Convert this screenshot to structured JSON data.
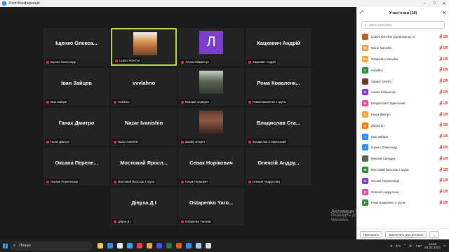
{
  "window": {
    "title": "Zoom Конференція",
    "controls": [
      "–",
      "□",
      "✕"
    ]
  },
  "gallery": {
    "tiles": [
      {
        "name": "Іщенко  Олекса...",
        "badge": "Іщенко Олександр",
        "kind": "name"
      },
      {
        "name": "",
        "badge": "Liubov Honchar",
        "kind": "photo",
        "photo": "ph-lyubov",
        "active": true
      },
      {
        "name": "",
        "badge": "Алина Кобринчук",
        "kind": "letter",
        "letter": "Л"
      },
      {
        "name": "Хацкевич  Андрій",
        "badge": "Хацкевич Андрій",
        "kind": "name"
      },
      {
        "name": "Іван  Зайцев",
        "badge": "Іван Зайцев",
        "kind": "name"
      },
      {
        "name": "vvvlahno",
        "badge": "vvvlahno",
        "kind": "name"
      },
      {
        "name": "",
        "badge": "Максим Середюк",
        "kind": "photo",
        "photo": "ph-maksym"
      },
      {
        "name": "Рома  Коваленк...",
        "badge": "Рома Коваленко 2 група",
        "kind": "name"
      },
      {
        "name": "Ганах  Дмитро",
        "badge": "Ганах Дмитро",
        "kind": "name"
      },
      {
        "name": "Nazar  Ivanishin",
        "badge": "Nazar Ivanishin",
        "kind": "name"
      },
      {
        "name": "",
        "badge": "Zavaliy Dmytro",
        "kind": "photo",
        "photo": "ph-zavaliy"
      },
      {
        "name": "Владислав  Ста...",
        "badge": "Владислав Старинський",
        "kind": "name"
      },
      {
        "name": "Оксана  Перепе...",
        "badge": "Оксана Перепелиця",
        "kind": "name"
      },
      {
        "name": "Мостовий  Яросл...",
        "badge": "Мостовий Ярослав 2 група",
        "kind": "name"
      },
      {
        "name": "Севак  Норікович",
        "badge": "Севак Норікович",
        "kind": "name"
      },
      {
        "name": "Олексій  Андру...",
        "badge": "Олексій Андрусенко",
        "kind": "name"
      },
      {
        "name": "Дівуха  Д  І",
        "badge": "Дівуха Д І",
        "kind": "name"
      },
      {
        "name": "Ostapenko  Yaro...",
        "badge": "Ostapenko Yaroslav",
        "kind": "name"
      }
    ]
  },
  "watermark": {
    "title": "Активаця Windows",
    "line1": "Перейдіть до розділу ''Настройки'', щоб",
    "line2": "Windows."
  },
  "participants_panel": {
    "title": "Участники (18)",
    "search_placeholder": "Найти участника",
    "items": [
      {
        "name": "Liubov Honchar (Організатор, я)",
        "initials": "",
        "color": "#b5651d"
      },
      {
        "name": "Nazar Ivanishin",
        "initials": "NI",
        "color": "#f2a33a"
      },
      {
        "name": "Ostapenko Yaroslav",
        "initials": "OY",
        "color": "#f2a33a"
      },
      {
        "name": "vvvlahno",
        "initials": "V",
        "color": "#2b8f3e"
      },
      {
        "name": "Zavaliy Dmytro",
        "initials": "",
        "color": "#6b3b2a"
      },
      {
        "name": "Алина Кобринчук",
        "initials": "Л",
        "color": "#7a3ec9"
      },
      {
        "name": "Владислав Старинський",
        "initials": "В",
        "color": "#e0509a"
      },
      {
        "name": "Ганах Дмитро",
        "initials": "Г",
        "color": "#f2a33a"
      },
      {
        "name": "Дівуха Д І",
        "initials": "Д",
        "color": "#f27a1a"
      },
      {
        "name": "Іван Зайцев",
        "initials": "І",
        "color": "#2d8cff"
      },
      {
        "name": "Іщенко Олександр",
        "initials": "І",
        "color": "#2d8cff"
      },
      {
        "name": "Максим Середюк",
        "initials": "",
        "color": "#5a6551"
      },
      {
        "name": "Мостовий Ярослав 2 група",
        "initials": "М",
        "color": "#2b8f3e"
      },
      {
        "name": "Оксана Перепелиця",
        "initials": "О",
        "color": "#7a3ec9"
      },
      {
        "name": "Олексій Андрусенко",
        "initials": "О",
        "color": "#e0509a"
      },
      {
        "name": "Рома Коваленко 2 група",
        "initials": "Р",
        "color": "#2b8f3e"
      }
    ],
    "invite_label": "Пригласить",
    "mute_all_label": "Выключить звук для всех",
    "more_label": "..."
  },
  "taskbar": {
    "search_text": "Пошук",
    "weather": "3°C",
    "lang": "УКР",
    "time": "11:32",
    "date": "03.03.2023",
    "apps": [
      "#f2c94c",
      "#2d8cff",
      "#e8e8e8",
      "#3aa0f2",
      "#e24040",
      "#f2a33a",
      "#4a4aff",
      "#1f7a3b",
      "#e05a2a",
      "#2d8cff",
      "#9ad0f5",
      "#ddd"
    ]
  },
  "colors": {
    "accent": "#2d8cff",
    "active_speaker": "#b9d94b",
    "muted": "#e02f2f"
  }
}
